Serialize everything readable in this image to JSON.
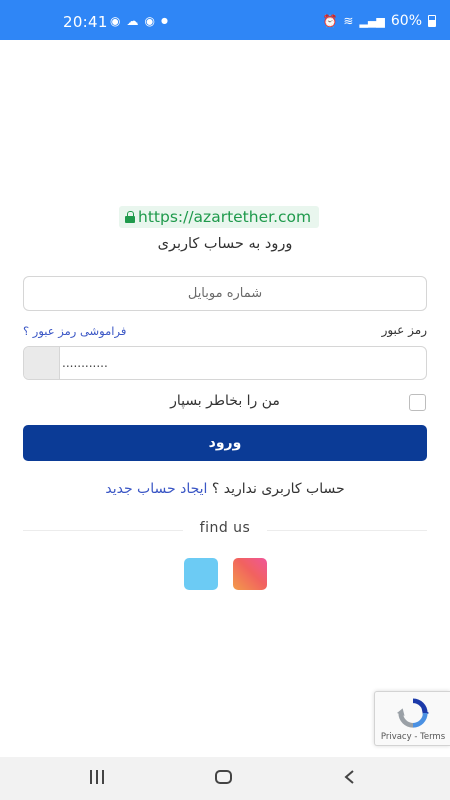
{
  "status_bar": {
    "time": "20:41",
    "battery": "60%",
    "left_icons": [
      "notification-icon",
      "notification-icon",
      "cloud-icon",
      "notification-icon",
      "dot-icon"
    ],
    "right_icons": [
      "alarm-icon",
      "wifi-icon",
      "signal-icon",
      "signal-icon",
      "battery-icon"
    ]
  },
  "url_badge": {
    "text": "https://azartether.com"
  },
  "page_title": "ورود به حساب کاربری",
  "mobile_field": {
    "placeholder": "شماره موبایل",
    "value": ""
  },
  "password": {
    "label": "رمز عبور",
    "forgot_link": "فراموشی رمز عبور ؟",
    "value": "............"
  },
  "remember_me": {
    "label": "من را بخاطر بسپار",
    "checked": false
  },
  "submit_label": "ورود",
  "signup": {
    "prompt": "حساب کاربری ندارید ؟",
    "link": "ایجاد حساب جدید"
  },
  "find_us": "find us",
  "social": [
    {
      "name": "telegram",
      "color": "#6ccbf4"
    },
    {
      "name": "instagram",
      "color": "#f1625f"
    }
  ],
  "recaptcha": {
    "text": "Privacy - Terms"
  },
  "colors": {
    "status_bar": "#2f86f6",
    "primary": "#0b3b96",
    "link": "#3a56c5",
    "url": "#1f9a4c"
  }
}
